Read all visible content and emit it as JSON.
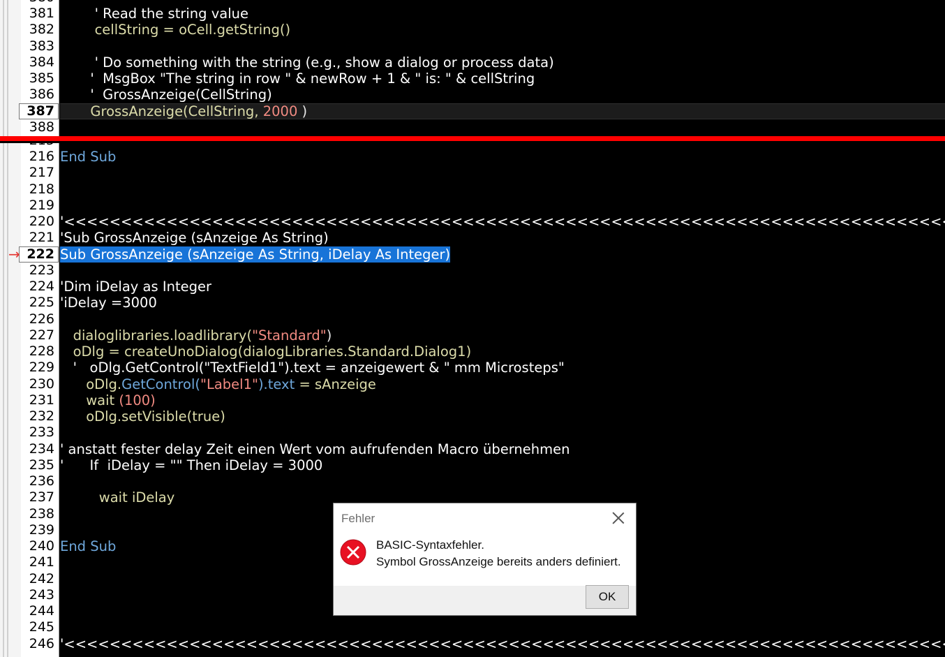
{
  "top_pane": {
    "partial_number": "380",
    "lines": [
      {
        "num": "381",
        "parts": [
          {
            "t": "        ' Read the string value",
            "c": "def"
          }
        ]
      },
      {
        "num": "382",
        "parts": [
          {
            "t": "        cellString = oCell.getString()",
            "c": "ident"
          }
        ]
      },
      {
        "num": "383",
        "parts": []
      },
      {
        "num": "384",
        "parts": [
          {
            "t": "        ' Do something with the string (e.g., show a dialog or process data)",
            "c": "def"
          }
        ]
      },
      {
        "num": "385",
        "parts": [
          {
            "t": "       '  MsgBox \"The string in row \" & newRow + 1 & \" is: \" & cellString",
            "c": "def"
          }
        ]
      },
      {
        "num": "386",
        "parts": [
          {
            "t": "       '  GrossAnzeige(CellString)",
            "c": "def"
          }
        ]
      },
      {
        "num": "387",
        "current": true,
        "parts": [
          {
            "t": "       GrossAnzeige(CellString, ",
            "c": "ident"
          },
          {
            "t": "2000",
            "c": "num"
          },
          {
            "t": " )",
            "c": "op"
          }
        ]
      },
      {
        "num": "388",
        "parts": []
      }
    ]
  },
  "bottom_pane": {
    "partial_number": "215",
    "lines": [
      {
        "num": "216",
        "parts": [
          {
            "t": "End Sub",
            "c": "kw"
          }
        ]
      },
      {
        "num": "217",
        "parts": []
      },
      {
        "num": "218",
        "parts": []
      },
      {
        "num": "219",
        "parts": []
      },
      {
        "num": "220",
        "parts": [
          {
            "t": "'<<<<<<<<<<<<<<<<<<<<<<<<<<<<<<<<<<<<<<<<<<<<<<<<<<<<<<<<<<<<<<<<<<<<<<<<<<<<<<<<<<<<<<<<<<<<",
            "c": "def"
          }
        ]
      },
      {
        "num": "221",
        "parts": [
          {
            "t": "'Sub GrossAnzeige (sAnzeige As String)",
            "c": "def"
          }
        ]
      },
      {
        "num": "222",
        "current": true,
        "selected": true,
        "marker": "→",
        "parts": [
          {
            "t": "Sub GrossAnzeige (sAnzeige As String, iDelay As Integer)",
            "c": "def"
          }
        ]
      },
      {
        "num": "223",
        "parts": []
      },
      {
        "num": "224",
        "parts": [
          {
            "t": "'Dim iDelay as Integer",
            "c": "def"
          }
        ]
      },
      {
        "num": "225",
        "parts": [
          {
            "t": "'iDelay =3000",
            "c": "def"
          }
        ]
      },
      {
        "num": "226",
        "parts": []
      },
      {
        "num": "227",
        "parts": [
          {
            "t": "   dialoglibraries.loadlibrary(",
            "c": "ident"
          },
          {
            "t": "\"Standard\"",
            "c": "str"
          },
          {
            "t": ")",
            "c": "op"
          }
        ]
      },
      {
        "num": "228",
        "parts": [
          {
            "t": "   oDlg = createUnoDialog(dialogLibraries.Standard.Dialog1)",
            "c": "ident"
          }
        ]
      },
      {
        "num": "229",
        "parts": [
          {
            "t": "   '   oDlg.GetControl(\"TextField1\").text = anzeigewert & \" mm Microsteps\"",
            "c": "def"
          }
        ]
      },
      {
        "num": "230",
        "parts": [
          {
            "t": "      oDlg.",
            "c": "ident"
          },
          {
            "t": "GetControl(",
            "c": "kw"
          },
          {
            "t": "\"Label1\"",
            "c": "str"
          },
          {
            "t": ").text",
            "c": "kw"
          },
          {
            "t": " = sAnzeige",
            "c": "ident"
          }
        ]
      },
      {
        "num": "231",
        "parts": [
          {
            "t": "      wait ",
            "c": "ident"
          },
          {
            "t": "(100)",
            "c": "num"
          }
        ]
      },
      {
        "num": "232",
        "parts": [
          {
            "t": "      oDlg.setVisible(true)",
            "c": "ident"
          }
        ]
      },
      {
        "num": "233",
        "parts": []
      },
      {
        "num": "234",
        "parts": [
          {
            "t": "' anstatt fester delay Zeit einen Wert vom aufrufenden Macro übernehmen",
            "c": "def"
          }
        ]
      },
      {
        "num": "235",
        "parts": [
          {
            "t": "'      If  iDelay = \"\" Then iDelay = 3000",
            "c": "def"
          }
        ]
      },
      {
        "num": "236",
        "parts": []
      },
      {
        "num": "237",
        "parts": [
          {
            "t": "         wait iDelay",
            "c": "ident"
          }
        ]
      },
      {
        "num": "238",
        "parts": []
      },
      {
        "num": "239",
        "parts": []
      },
      {
        "num": "240",
        "parts": [
          {
            "t": "End Sub",
            "c": "kw"
          }
        ]
      },
      {
        "num": "241",
        "parts": []
      },
      {
        "num": "242",
        "parts": []
      },
      {
        "num": "243",
        "parts": []
      },
      {
        "num": "244",
        "parts": []
      },
      {
        "num": "245",
        "parts": []
      },
      {
        "num": "246",
        "parts": [
          {
            "t": "'<<<<<<<<<<<<<<<<<<<<<<<<<<<<<<<<<<<<<<<<<<<<<<<<<<<<<<<<<<<<<<<<<<<<<<<<<<<<<<<<<<<<<<<<<<<<",
            "c": "def"
          }
        ]
      }
    ]
  },
  "dialog": {
    "title": "Fehler",
    "message_line1": "BASIC-Syntaxfehler.",
    "message_line2": "Symbol GrossAnzeige bereits anders definiert.",
    "ok_label": "OK",
    "icon": "error-icon",
    "colors": {
      "icon_fill": "#e81123"
    }
  },
  "colors": {
    "editor_bg": "#000000",
    "identifier": "#dcdcaa",
    "number_string": "#f28b82",
    "keyword": "#6fa8dc",
    "selection": "#1874d8",
    "split_line": "#ff0000"
  }
}
